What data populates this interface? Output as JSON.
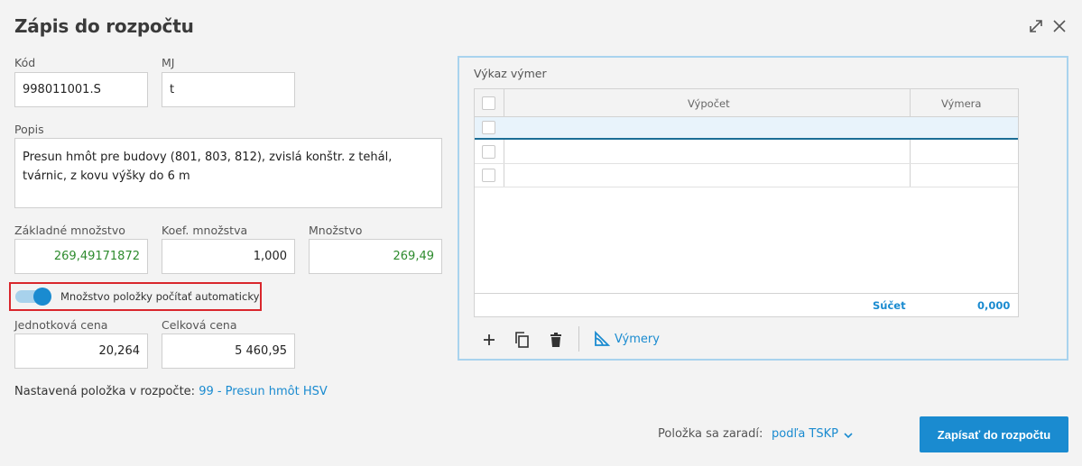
{
  "dialog": {
    "title": "Zápis do rozpočtu",
    "expand_icon": "expand-icon",
    "close_icon": "close-icon"
  },
  "form": {
    "kod_label": "Kód",
    "kod_value": "998011001.S",
    "mj_label": "MJ",
    "mj_value": "t",
    "popis_label": "Popis",
    "popis_value": "Presun hmôt pre budovy (801, 803, 812), zvislá konštr. z tehál, tvárnic, z kovu výšky do 6 m",
    "zakladne_label": "Základné množstvo",
    "zakladne_value": "269,49171872",
    "koef_label": "Koef. množstva",
    "koef_value": "1,000",
    "mnozstvo_label": "Množstvo",
    "mnozstvo_value": "269,49",
    "toggle_label": "Množstvo položky počítať automaticky",
    "toggle_on": true,
    "jednotkova_label": "Jednotková cena",
    "jednotkova_value": "20,264",
    "celkova_label": "Celková cena",
    "celkova_value": "5 460,95",
    "info_label": "Nastavená položka v rozpočte:",
    "info_link": "99 - Presun hmôt HSV"
  },
  "vykaz": {
    "title": "Výkaz výmer",
    "columns": [
      "Výpočet",
      "Výmera"
    ],
    "rows": [
      {
        "vypocet": "",
        "vymera": ""
      },
      {
        "vypocet": "",
        "vymera": ""
      },
      {
        "vypocet": "",
        "vymera": ""
      }
    ],
    "sum_label": "Súčet",
    "sum_value": "0,000",
    "toolbar": {
      "add_icon": "plus-icon",
      "copy_icon": "copy-icon",
      "delete_icon": "trash-icon",
      "vymery_icon": "ruler-triangle-icon",
      "vymery_label": "Výmery"
    }
  },
  "footer": {
    "zaradit_label": "Položka sa zaradí:",
    "zaradit_value": "podľa TSKP",
    "submit_label": "Zapísať do rozpočtu"
  },
  "colors": {
    "accent": "#1a8bd0",
    "positive_value": "#2e8b2e",
    "highlight_border": "#d9262c"
  }
}
